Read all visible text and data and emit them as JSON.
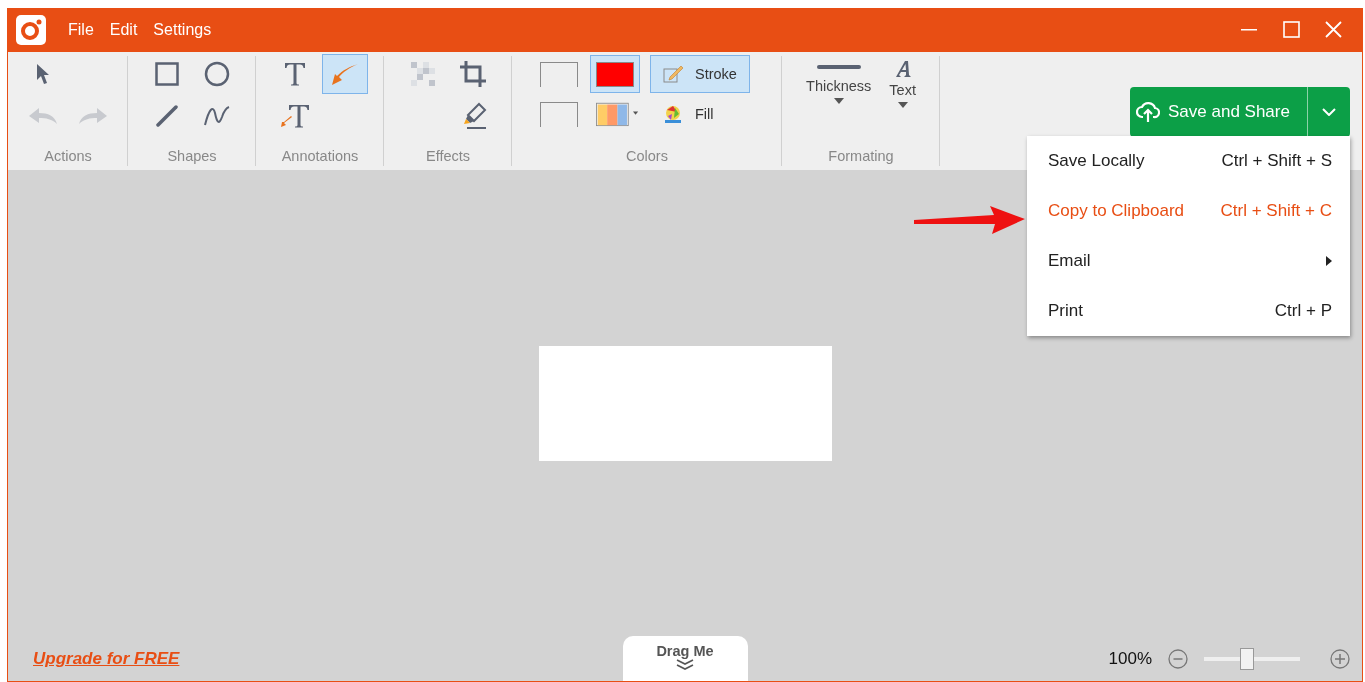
{
  "menu": [
    {
      "label": "File"
    },
    {
      "label": "Edit"
    },
    {
      "label": "Settings"
    }
  ],
  "toolbar": [
    {
      "label": "Actions",
      "tools": [
        {
          "kind": "pointer",
          "selected": false,
          "disabled": false
        },
        {
          "kind": "undo",
          "selected": false,
          "disabled": true
        },
        {
          "kind": "redo",
          "selected": false,
          "disabled": true
        }
      ]
    },
    {
      "label": "Shapes",
      "tools": [
        {
          "kind": "rectangle",
          "selected": false,
          "disabled": false
        },
        {
          "kind": "ellipse",
          "selected": false,
          "disabled": false
        },
        {
          "kind": "line",
          "selected": false,
          "disabled": false
        },
        {
          "kind": "freehand",
          "selected": false,
          "disabled": false
        }
      ]
    },
    {
      "label": "Annotations",
      "tools": [
        {
          "kind": "text",
          "selected": false,
          "disabled": false
        },
        {
          "kind": "arrow",
          "selected": true,
          "disabled": false
        },
        {
          "kind": "callout",
          "selected": false,
          "disabled": false
        }
      ]
    },
    {
      "label": "Effects",
      "tools": [
        {
          "kind": "pixelate",
          "selected": false,
          "disabled": false
        },
        {
          "kind": "crop",
          "selected": false,
          "disabled": false
        },
        {
          "kind": "highlighter",
          "selected": false,
          "disabled": false
        }
      ]
    }
  ],
  "colors": {
    "label": "Colors",
    "swatches": [
      {
        "kind": "empty",
        "selected": false
      },
      {
        "kind": "solid",
        "color": "#ff0000",
        "selected": true
      },
      {
        "kind": "empty",
        "selected": false
      },
      {
        "kind": "palette",
        "selected": false
      }
    ],
    "modes": [
      {
        "kind": "stroke",
        "label": "Stroke",
        "selected": true
      },
      {
        "kind": "fill",
        "label": "Fill",
        "selected": false
      }
    ]
  },
  "formatting": {
    "label": "Formating",
    "options": [
      {
        "kind": "thickness",
        "label": "Thickness"
      },
      {
        "kind": "font",
        "label": "Text"
      }
    ]
  },
  "save_button": {
    "label": "Save and Share"
  },
  "save_menu": [
    {
      "kind": "command",
      "label": "Save Locally",
      "shortcut": "Ctrl + Shift + S",
      "selected": false
    },
    {
      "kind": "command",
      "label": "Copy to Clipboard",
      "shortcut": "Ctrl + Shift + C",
      "selected": true
    },
    {
      "kind": "submenu",
      "label": "Email",
      "selected": false
    },
    {
      "kind": "command",
      "label": "Print",
      "shortcut": "Ctrl + P",
      "selected": false
    }
  ],
  "upgrade_link": "Upgrade for FREE",
  "drag_handle": "Drag Me",
  "zoom": {
    "reading": "100%",
    "level": 0.45
  }
}
